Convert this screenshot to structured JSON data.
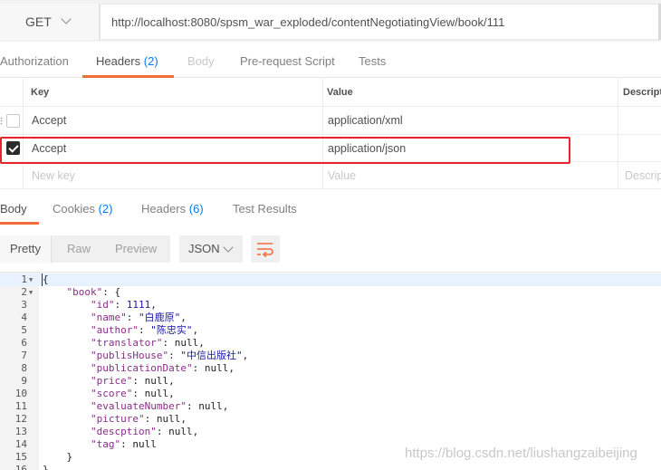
{
  "request": {
    "method": "GET",
    "url": "http://localhost:8080/spsm_war_exploded/contentNegotiatingView/book/111"
  },
  "request_tabs": [
    {
      "label": "Authorization",
      "count": ""
    },
    {
      "label": "Headers",
      "count": "(2)"
    },
    {
      "label": "Body",
      "count": ""
    },
    {
      "label": "Pre-request Script",
      "count": ""
    },
    {
      "label": "Tests",
      "count": ""
    }
  ],
  "headers_table": {
    "columns": [
      "Key",
      "Value",
      "Descript"
    ],
    "rows": [
      {
        "checked": false,
        "key": "Accept",
        "value": "application/xml",
        "description": ""
      },
      {
        "checked": true,
        "key": "Accept",
        "value": "application/json",
        "description": ""
      }
    ],
    "new_row": {
      "key_placeholder": "New key",
      "value_placeholder": "Value",
      "description_placeholder": "Descrip"
    }
  },
  "response_tabs": [
    {
      "label": "Body",
      "count": ""
    },
    {
      "label": "Cookies",
      "count": "(2)"
    },
    {
      "label": "Headers",
      "count": "(6)"
    },
    {
      "label": "Test Results",
      "count": ""
    }
  ],
  "response_toolbar": {
    "views": [
      "Pretty",
      "Raw",
      "Preview"
    ],
    "format": "JSON"
  },
  "code_lines": [
    {
      "n": "1",
      "fold": true,
      "parts": [
        [
          "p",
          "{"
        ]
      ]
    },
    {
      "n": "2",
      "fold": true,
      "parts": [
        [
          "p",
          "    "
        ],
        [
          "k",
          "\"book\""
        ],
        [
          "p",
          ": {"
        ]
      ]
    },
    {
      "n": "3",
      "fold": false,
      "parts": [
        [
          "p",
          "        "
        ],
        [
          "k",
          "\"id\""
        ],
        [
          "p",
          ": "
        ],
        [
          "n",
          "1111"
        ],
        [
          "p",
          ","
        ]
      ]
    },
    {
      "n": "4",
      "fold": false,
      "parts": [
        [
          "p",
          "        "
        ],
        [
          "k",
          "\"name\""
        ],
        [
          "p",
          ": "
        ],
        [
          "s",
          "\"白鹿原\""
        ],
        [
          "p",
          ","
        ]
      ]
    },
    {
      "n": "5",
      "fold": false,
      "parts": [
        [
          "p",
          "        "
        ],
        [
          "k",
          "\"author\""
        ],
        [
          "p",
          ": "
        ],
        [
          "s",
          "\"陈忠实\""
        ],
        [
          "p",
          ","
        ]
      ]
    },
    {
      "n": "6",
      "fold": false,
      "parts": [
        [
          "p",
          "        "
        ],
        [
          "k",
          "\"translator\""
        ],
        [
          "p",
          ": null,"
        ]
      ]
    },
    {
      "n": "7",
      "fold": false,
      "parts": [
        [
          "p",
          "        "
        ],
        [
          "k",
          "\"publisHouse\""
        ],
        [
          "p",
          ": "
        ],
        [
          "s",
          "\"中信出版社\""
        ],
        [
          "p",
          ","
        ]
      ]
    },
    {
      "n": "8",
      "fold": false,
      "parts": [
        [
          "p",
          "        "
        ],
        [
          "k",
          "\"publicationDate\""
        ],
        [
          "p",
          ": null,"
        ]
      ]
    },
    {
      "n": "9",
      "fold": false,
      "parts": [
        [
          "p",
          "        "
        ],
        [
          "k",
          "\"price\""
        ],
        [
          "p",
          ": null,"
        ]
      ]
    },
    {
      "n": "10",
      "fold": false,
      "parts": [
        [
          "p",
          "        "
        ],
        [
          "k",
          "\"score\""
        ],
        [
          "p",
          ": null,"
        ]
      ]
    },
    {
      "n": "11",
      "fold": false,
      "parts": [
        [
          "p",
          "        "
        ],
        [
          "k",
          "\"evaluateNumber\""
        ],
        [
          "p",
          ": null,"
        ]
      ]
    },
    {
      "n": "12",
      "fold": false,
      "parts": [
        [
          "p",
          "        "
        ],
        [
          "k",
          "\"picture\""
        ],
        [
          "p",
          ": null,"
        ]
      ]
    },
    {
      "n": "13",
      "fold": false,
      "parts": [
        [
          "p",
          "        "
        ],
        [
          "k",
          "\"descption\""
        ],
        [
          "p",
          ": null,"
        ]
      ]
    },
    {
      "n": "14",
      "fold": false,
      "parts": [
        [
          "p",
          "        "
        ],
        [
          "k",
          "\"tag\""
        ],
        [
          "p",
          ": null"
        ]
      ]
    },
    {
      "n": "15",
      "fold": false,
      "parts": [
        [
          "p",
          "    }"
        ]
      ]
    },
    {
      "n": "16",
      "fold": false,
      "parts": [
        [
          "p",
          "}"
        ]
      ]
    }
  ],
  "watermark": "https://blog.csdn.net/liushangzaibeijing",
  "colors": {
    "accent": "#f26b3a",
    "count": "#097bed",
    "highlight_border": "#e8232b"
  }
}
